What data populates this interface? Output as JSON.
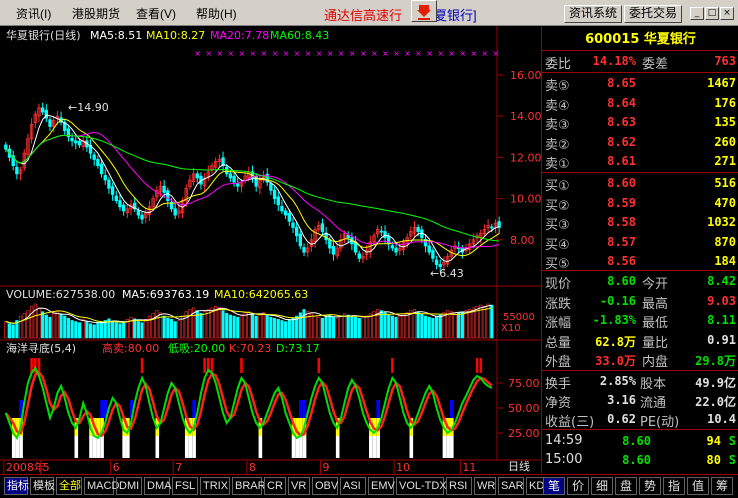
{
  "menu": {
    "items": [
      "资讯(I)",
      "港股期货",
      "查看(V)",
      "帮助(H)"
    ],
    "title_red": "通达信高速行",
    "title_blue": "夏银行]",
    "btn_info": "资讯系统",
    "btn_trade": "委托交易",
    "win_min": "_",
    "win_max": "□",
    "win_close": "×"
  },
  "colors": {
    "bg": "#000000",
    "up": "#ff3030",
    "down": "#00ffff",
    "ma5": "#ffffff",
    "ma10": "#ffff00",
    "ma20": "#ff00ff",
    "ma60": "#00ff00",
    "border": "#a00000"
  },
  "chart_data": [
    {
      "type": "candlestick",
      "title": "华夏银行(日线)",
      "ma_labels": [
        "MA5:8.51",
        "MA10:8.27",
        "MA20:7.78",
        "MA60:8.43"
      ],
      "y_ticks": [
        8.0,
        10.0,
        12.0,
        14.0,
        16.0
      ],
      "y_tick_labels": [
        "8.00",
        "10.00",
        "12.00",
        "14.00",
        "16.00"
      ],
      "ylim": [
        6.0,
        17.5
      ],
      "annotations": {
        "high": "14.90",
        "low": "6.43"
      },
      "x_labels": [
        "2008年",
        "5",
        "6",
        "7",
        "8",
        "9",
        "10",
        "11"
      ],
      "x_label_index": [
        0,
        10,
        29,
        46,
        66,
        86,
        106,
        124
      ],
      "x_period_label": "日线",
      "close": [
        12.4,
        12.0,
        11.6,
        11.2,
        11.4,
        12.2,
        12.9,
        13.6,
        14.1,
        14.4,
        14.2,
        13.9,
        13.5,
        13.8,
        14.0,
        13.7,
        13.3,
        13.0,
        12.8,
        12.7,
        12.6,
        12.8,
        12.5,
        12.2,
        11.9,
        11.6,
        11.2,
        10.9,
        10.5,
        10.2,
        9.9,
        9.6,
        9.4,
        9.5,
        9.7,
        9.5,
        9.2,
        9.0,
        9.3,
        9.6,
        10.0,
        10.4,
        10.6,
        10.3,
        9.9,
        9.5,
        9.2,
        9.4,
        9.9,
        10.5,
        10.9,
        11.2,
        11.0,
        10.7,
        11.0,
        11.3,
        11.6,
        11.8,
        11.9,
        11.6,
        11.2,
        11.0,
        10.8,
        10.6,
        10.8,
        11.1,
        11.3,
        11.0,
        10.6,
        10.9,
        11.1,
        10.8,
        10.4,
        10.0,
        9.7,
        9.4,
        9.2,
        8.9,
        8.6,
        8.2,
        7.7,
        7.4,
        7.6,
        8.0,
        8.5,
        8.7,
        8.4,
        8.0,
        7.6,
        7.3,
        7.6,
        8.0,
        8.3,
        8.1,
        7.8,
        7.4,
        7.1,
        7.2,
        7.5,
        7.9,
        8.2,
        8.5,
        8.4,
        8.1,
        7.8,
        7.6,
        7.4,
        7.6,
        7.9,
        8.1,
        8.4,
        8.6,
        8.4,
        8.1,
        7.7,
        7.4,
        7.1,
        6.8,
        6.7,
        6.9,
        7.2,
        7.5,
        7.7,
        7.6,
        7.4,
        7.6,
        7.8,
        8.0,
        8.2,
        8.3,
        8.5,
        8.7,
        8.6,
        8.8,
        8.6
      ],
      "volume": {
        "label": "VOLUME:627538.00",
        "ma5": "MA5:693763.19",
        "ma10": "MA10:642065.63",
        "axis_label": "55000",
        "multiplier": "X10",
        "values": [
          30,
          26,
          24,
          32,
          40,
          45,
          50,
          58,
          62,
          55,
          48,
          42,
          38,
          45,
          50,
          44,
          40,
          36,
          32,
          30,
          28,
          34,
          30,
          26,
          24,
          28,
          30,
          32,
          35,
          30,
          28,
          26,
          30,
          34,
          38,
          35,
          30,
          28,
          34,
          40,
          45,
          50,
          46,
          40,
          36,
          34,
          30,
          32,
          40,
          48,
          52,
          55,
          50,
          45,
          48,
          52,
          55,
          58,
          56,
          50,
          45,
          42,
          40,
          38,
          42,
          46,
          48,
          44,
          40,
          42,
          46,
          42,
          38,
          36,
          34,
          32,
          30,
          34,
          36,
          40,
          46,
          52,
          48,
          44,
          40,
          38,
          36,
          40,
          42,
          38,
          36,
          40,
          44,
          42,
          40,
          38,
          36,
          38,
          40,
          44,
          48,
          52,
          50,
          46,
          42,
          40,
          38,
          40,
          44,
          46,
          50,
          52,
          48,
          44,
          40,
          38,
          36,
          40,
          42,
          46,
          50,
          48,
          44,
          46,
          48,
          50,
          52,
          55,
          58,
          60,
          58,
          62,
          60
        ]
      },
      "indicator": {
        "name": "海洋寻底(5,4)",
        "high_sell": "高卖:80.00",
        "low_buy": "低吸:20.00",
        "k": "K:70.23",
        "d": "D:73.17",
        "y_ticks": [
          25,
          50,
          75
        ],
        "y_tick_labels": [
          "25.00",
          "50.00",
          "75.00"
        ],
        "ylim": [
          0,
          100
        ],
        "k_values": [
          45,
          35,
          25,
          20,
          30,
          55,
          75,
          85,
          90,
          82,
          70,
          55,
          40,
          50,
          65,
          72,
          60,
          45,
          35,
          30,
          40,
          55,
          45,
          30,
          22,
          20,
          25,
          35,
          50,
          60,
          55,
          40,
          28,
          25,
          35,
          55,
          70,
          80,
          72,
          55,
          40,
          30,
          35,
          50,
          65,
          75,
          70,
          55,
          40,
          30,
          25,
          30,
          45,
          65,
          80,
          88,
          85,
          75,
          60,
          45,
          35,
          40,
          55,
          70,
          80,
          75,
          60,
          45,
          35,
          30,
          35,
          45,
          55,
          65,
          70,
          60,
          45,
          35,
          25,
          20,
          22,
          30,
          45,
          60,
          72,
          80,
          75,
          60,
          45,
          35,
          30,
          40,
          55,
          70,
          78,
          72,
          60,
          45,
          35,
          28,
          25,
          30,
          40,
          55,
          70,
          80,
          75,
          60,
          45,
          35,
          30,
          35,
          45,
          55,
          65,
          72,
          65,
          50,
          38,
          30,
          25,
          28,
          35,
          45,
          55,
          62,
          70,
          78,
          82,
          80,
          75,
          72,
          70
        ]
      }
    }
  ],
  "stock": {
    "code_name": "600015 华夏银行",
    "weibi_label": "委比",
    "weibi": "14.18%",
    "weicha_label": "委差",
    "weicha": "763",
    "sells": [
      {
        "label": "卖⑤",
        "price": "8.65",
        "vol": "1467"
      },
      {
        "label": "卖④",
        "price": "8.64",
        "vol": "176"
      },
      {
        "label": "卖③",
        "price": "8.63",
        "vol": "135"
      },
      {
        "label": "卖②",
        "price": "8.62",
        "vol": "260"
      },
      {
        "label": "卖①",
        "price": "8.61",
        "vol": "271"
      }
    ],
    "buys": [
      {
        "label": "买①",
        "price": "8.60",
        "vol": "516"
      },
      {
        "label": "买②",
        "price": "8.59",
        "vol": "470"
      },
      {
        "label": "买③",
        "price": "8.58",
        "vol": "1032"
      },
      {
        "label": "买④",
        "price": "8.57",
        "vol": "870"
      },
      {
        "label": "买⑤",
        "price": "8.56",
        "vol": "184"
      }
    ],
    "quote": [
      {
        "l1": "现价",
        "v1": "8.60",
        "c1": "grn",
        "l2": "今开",
        "v2": "8.42",
        "c2": "grn"
      },
      {
        "l1": "涨跌",
        "v1": "-0.16",
        "c1": "grn",
        "l2": "最高",
        "v2": "9.03",
        "c2": "red"
      },
      {
        "l1": "涨幅",
        "v1": "-1.83%",
        "c1": "grn",
        "l2": "最低",
        "v2": "8.11",
        "c2": "grn"
      },
      {
        "l1": "总量",
        "v1": "62.8万",
        "c1": "yel",
        "l2": "量比",
        "v2": "0.91",
        "c2": "wht"
      },
      {
        "l1": "外盘",
        "v1": "33.0万",
        "c1": "red",
        "l2": "内盘",
        "v2": "29.8万",
        "c2": "grn"
      }
    ],
    "finance": [
      {
        "l1": "换手",
        "v1": "2.85%",
        "l2": "股本",
        "v2": "49.9亿"
      },
      {
        "l1": "净资",
        "v1": "3.16",
        "l2": "流通",
        "v2": "22.0亿"
      },
      {
        "l1": "收益(三)",
        "v1": "0.62",
        "l2": "PE(动)",
        "v2": "10.4"
      }
    ],
    "ticks": [
      {
        "time": "14:59",
        "price": "8.60",
        "vol": "94",
        "flag": "S"
      },
      {
        "time": "15:00",
        "price": "8.60",
        "vol": "80",
        "flag": "S"
      }
    ]
  },
  "tabs": {
    "items": [
      "指标",
      "模板",
      "全部",
      "MACD",
      "DMI",
      "DMA",
      "FSL",
      "TRIX",
      "BRAR",
      "CR",
      "VR",
      "OBV",
      "ASI",
      "EMV",
      "VOL-TDX",
      "RSI",
      "WR",
      "SAR",
      "KDJ"
    ],
    "right": [
      "笔",
      "价",
      "细",
      "盘",
      "势",
      "指",
      "值",
      "筹"
    ]
  }
}
